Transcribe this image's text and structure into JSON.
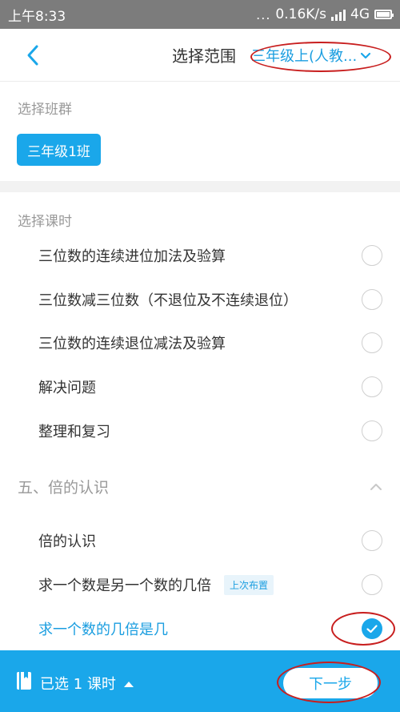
{
  "status_bar": {
    "time": "上午8:33",
    "dots": "...",
    "speed": "0.16K/s",
    "network": "4G"
  },
  "header": {
    "title": "选择范围",
    "grade_selector": "三年级上(人教...",
    "back_icon": "chevron-left-icon"
  },
  "class_section": {
    "label": "选择班群",
    "selected_class": "三年级1班"
  },
  "lesson_section": {
    "label": "选择课时",
    "lessons": [
      {
        "title": "三位数的连续进位加法及验算",
        "checked": false
      },
      {
        "title": "三位数减三位数（不退位及不连续退位）",
        "checked": false
      },
      {
        "title": "三位数的连续退位减法及验算",
        "checked": false
      },
      {
        "title": "解决问题",
        "checked": false
      },
      {
        "title": "整理和复习",
        "checked": false
      }
    ]
  },
  "unit_five": {
    "title": "五、倍的认识",
    "lessons": [
      {
        "title": "倍的认识",
        "checked": false,
        "tag": ""
      },
      {
        "title": "求一个数是另一个数的几倍",
        "checked": false,
        "tag": "上次布置"
      },
      {
        "title": "求一个数的几倍是几",
        "checked": true,
        "tag": ""
      }
    ]
  },
  "bottom_bar": {
    "selected_text": "已选 1 课时",
    "next_button": "下一步"
  },
  "colors": {
    "accent": "#1aa7ea",
    "status_bar": "#7c7c7c",
    "annotation": "#c81e1e"
  }
}
